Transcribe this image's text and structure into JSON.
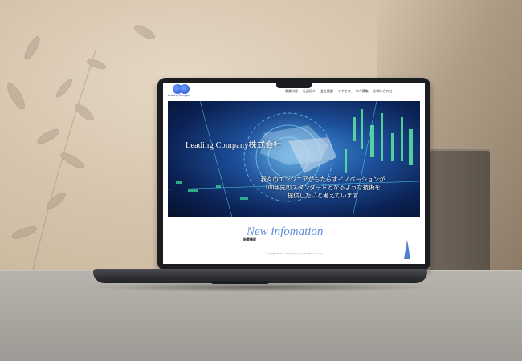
{
  "website": {
    "logo": {
      "icon": "double-circle-logo",
      "text": "Leading Company"
    },
    "nav": [
      "事業内容",
      "社員紹介",
      "会社概要",
      "アクセス",
      "求人募集",
      "お問い合わせ"
    ],
    "hero": {
      "title": "Leading Company株式会社",
      "lines": [
        "我々のエンジニアがもたらすイノベーションが",
        "100年先のスタンダードとなるような技術を",
        "提供したいと考えています"
      ]
    },
    "news": {
      "title": "New infomation",
      "subtitle": "新着情報"
    },
    "footer": "Copyright 2022 Leading Company All rights reserved.",
    "pagetop_icon": "page-top-arrow-icon"
  },
  "colors": {
    "accent": "#5f8fd8",
    "logo_blue": "#1f4fc7",
    "hero_dark": "#0c2356"
  }
}
